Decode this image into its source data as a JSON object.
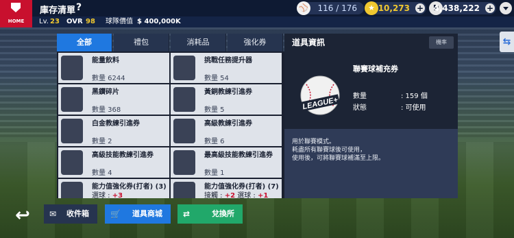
{
  "header": {
    "home_label": "HOME",
    "title": "庫存清單",
    "help": "?",
    "baseballs": "116 / 176",
    "stars": "10,273",
    "points": "4,438,222",
    "points_icon": "P"
  },
  "info": {
    "lv_label": "Lv.",
    "lv": "23",
    "ovr_label": "OVR",
    "ovr": "98",
    "value_label": "球隊價值",
    "value": "$ 400,000K"
  },
  "tabs": [
    {
      "label": "全部"
    },
    {
      "label": "禮包"
    },
    {
      "label": "消耗品"
    },
    {
      "label": "強化券"
    }
  ],
  "detail": {
    "header_title": "道具資訊",
    "close_label": "機率",
    "item_name": "聯賽球補充券",
    "ball_text": "LEAGUE+",
    "qty_label": "數量",
    "qty_value": ": 159 個",
    "status_label": "狀態",
    "status_value": ": 可使用",
    "desc_line1": "用於聯賽模式。",
    "desc_line2": "耗盡所有聯賽球後可使用，",
    "desc_line3": "使用後，可將聯賽球補滿至上限。"
  },
  "items": [
    {
      "name": "能量飲料",
      "qty": "數量 6244",
      "icon": "energy-drink-icon"
    },
    {
      "name": "挑戰任務提升器",
      "qty": "數量 54",
      "icon": "mission-booster-icon"
    },
    {
      "name": "黑鑽碎片",
      "qty": "數量 368",
      "icon": "diamond-shard-icon"
    },
    {
      "name": "黃銅教練引進券",
      "qty": "數量 5",
      "icon": "bronze-coach-ticket-icon"
    },
    {
      "name": "白金教練引進券",
      "qty": "數量 2",
      "icon": "platinum-coach-ticket-icon"
    },
    {
      "name": "高級教練引進券",
      "qty": "數量 6",
      "icon": "advanced-coach-ticket-icon"
    },
    {
      "name": "高級技能教練引進券",
      "qty": "數量 4",
      "icon": "advanced-skill-coach-ticket-icon"
    },
    {
      "name": "最高級技能教練引進券",
      "qty": "數量 1",
      "icon": "top-skill-coach-ticket-icon"
    },
    {
      "name": "能力值強化券(打者) (3)",
      "sub_label": "選球 : ",
      "sub_value": "+3",
      "icon": "batter-stat-boost-icon"
    },
    {
      "name": "能力值強化券(打者) (7)",
      "sub_label": "接觸 : ",
      "sub_value": "+2",
      "sub_label2": " 選球 : ",
      "sub_value2": "+1",
      "icon": "batter-stat-boost-icon"
    }
  ],
  "buttons": {
    "mailbox": "收件箱",
    "shop": "道具商城",
    "exchange": "兌換所"
  }
}
